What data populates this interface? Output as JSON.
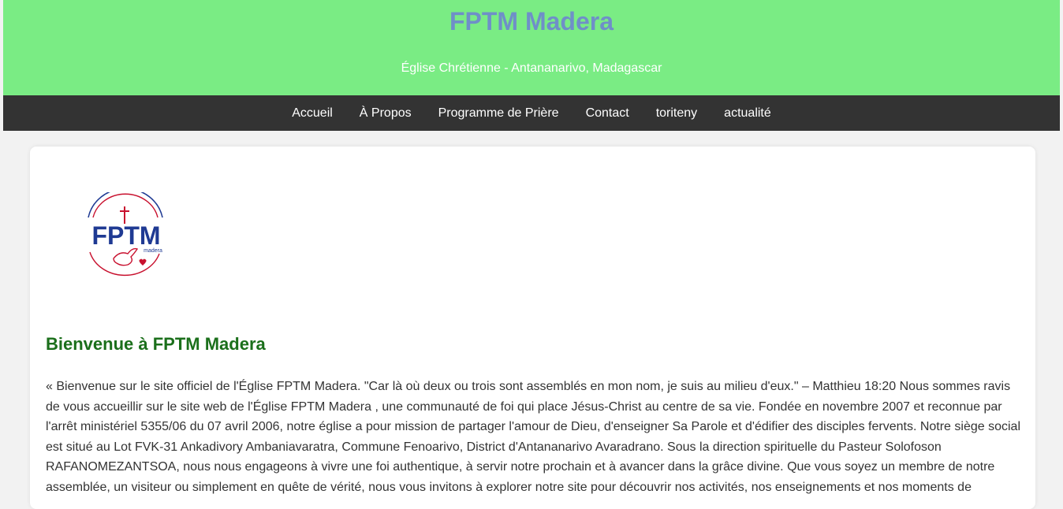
{
  "header": {
    "title": "FPTM Madera",
    "subtitle": "Église Chrétienne - Antananarivo, Madagascar"
  },
  "nav": {
    "items": [
      {
        "label": "Accueil"
      },
      {
        "label": "À Propos"
      },
      {
        "label": "Programme de Prière"
      },
      {
        "label": "Contact"
      },
      {
        "label": "toriteny"
      },
      {
        "label": "actualité"
      }
    ]
  },
  "logo": {
    "text": "FPTM",
    "subtext": "madera"
  },
  "main": {
    "heading": "Bienvenue à FPTM Madera",
    "paragraph": "« Bienvenue sur le site officiel de l'Église FPTM Madera. \"Car là où deux ou trois sont assemblés en mon nom, je suis au milieu d'eux.\" – Matthieu 18:20 Nous sommes ravis de vous accueillir sur le site web de l'Église FPTM Madera , une communauté de foi qui place Jésus-Christ au centre de sa vie. Fondée en novembre 2007 et reconnue par l'arrêt ministériel 5355/06 du 07 avril 2006, notre église a pour mission de partager l'amour de Dieu, d'enseigner Sa Parole et d'édifier des disciples fervents. Notre siège social est situé au Lot FVK-31 Ankadivory Ambaniavaratra, Commune Fenoarivo, District d'Antananarivo Avaradrano. Sous la direction spirituelle du Pasteur Solofoson RAFANOMEZANTSOA, nous nous engageons à vivre une foi authentique, à servir notre prochain et à avancer dans la grâce divine. Que vous soyez un membre de notre assemblée, un visiteur ou simplement en quête de vérité, nous vous invitons à explorer notre site pour découvrir nos activités, nos enseignements et nos moments de"
  },
  "colors": {
    "header_bg": "#7aec84",
    "title": "#6f8fc8",
    "nav_bg": "#333333",
    "heading": "#1b6f1b",
    "logo_blue": "#1f3a93",
    "logo_red": "#c8102e"
  }
}
